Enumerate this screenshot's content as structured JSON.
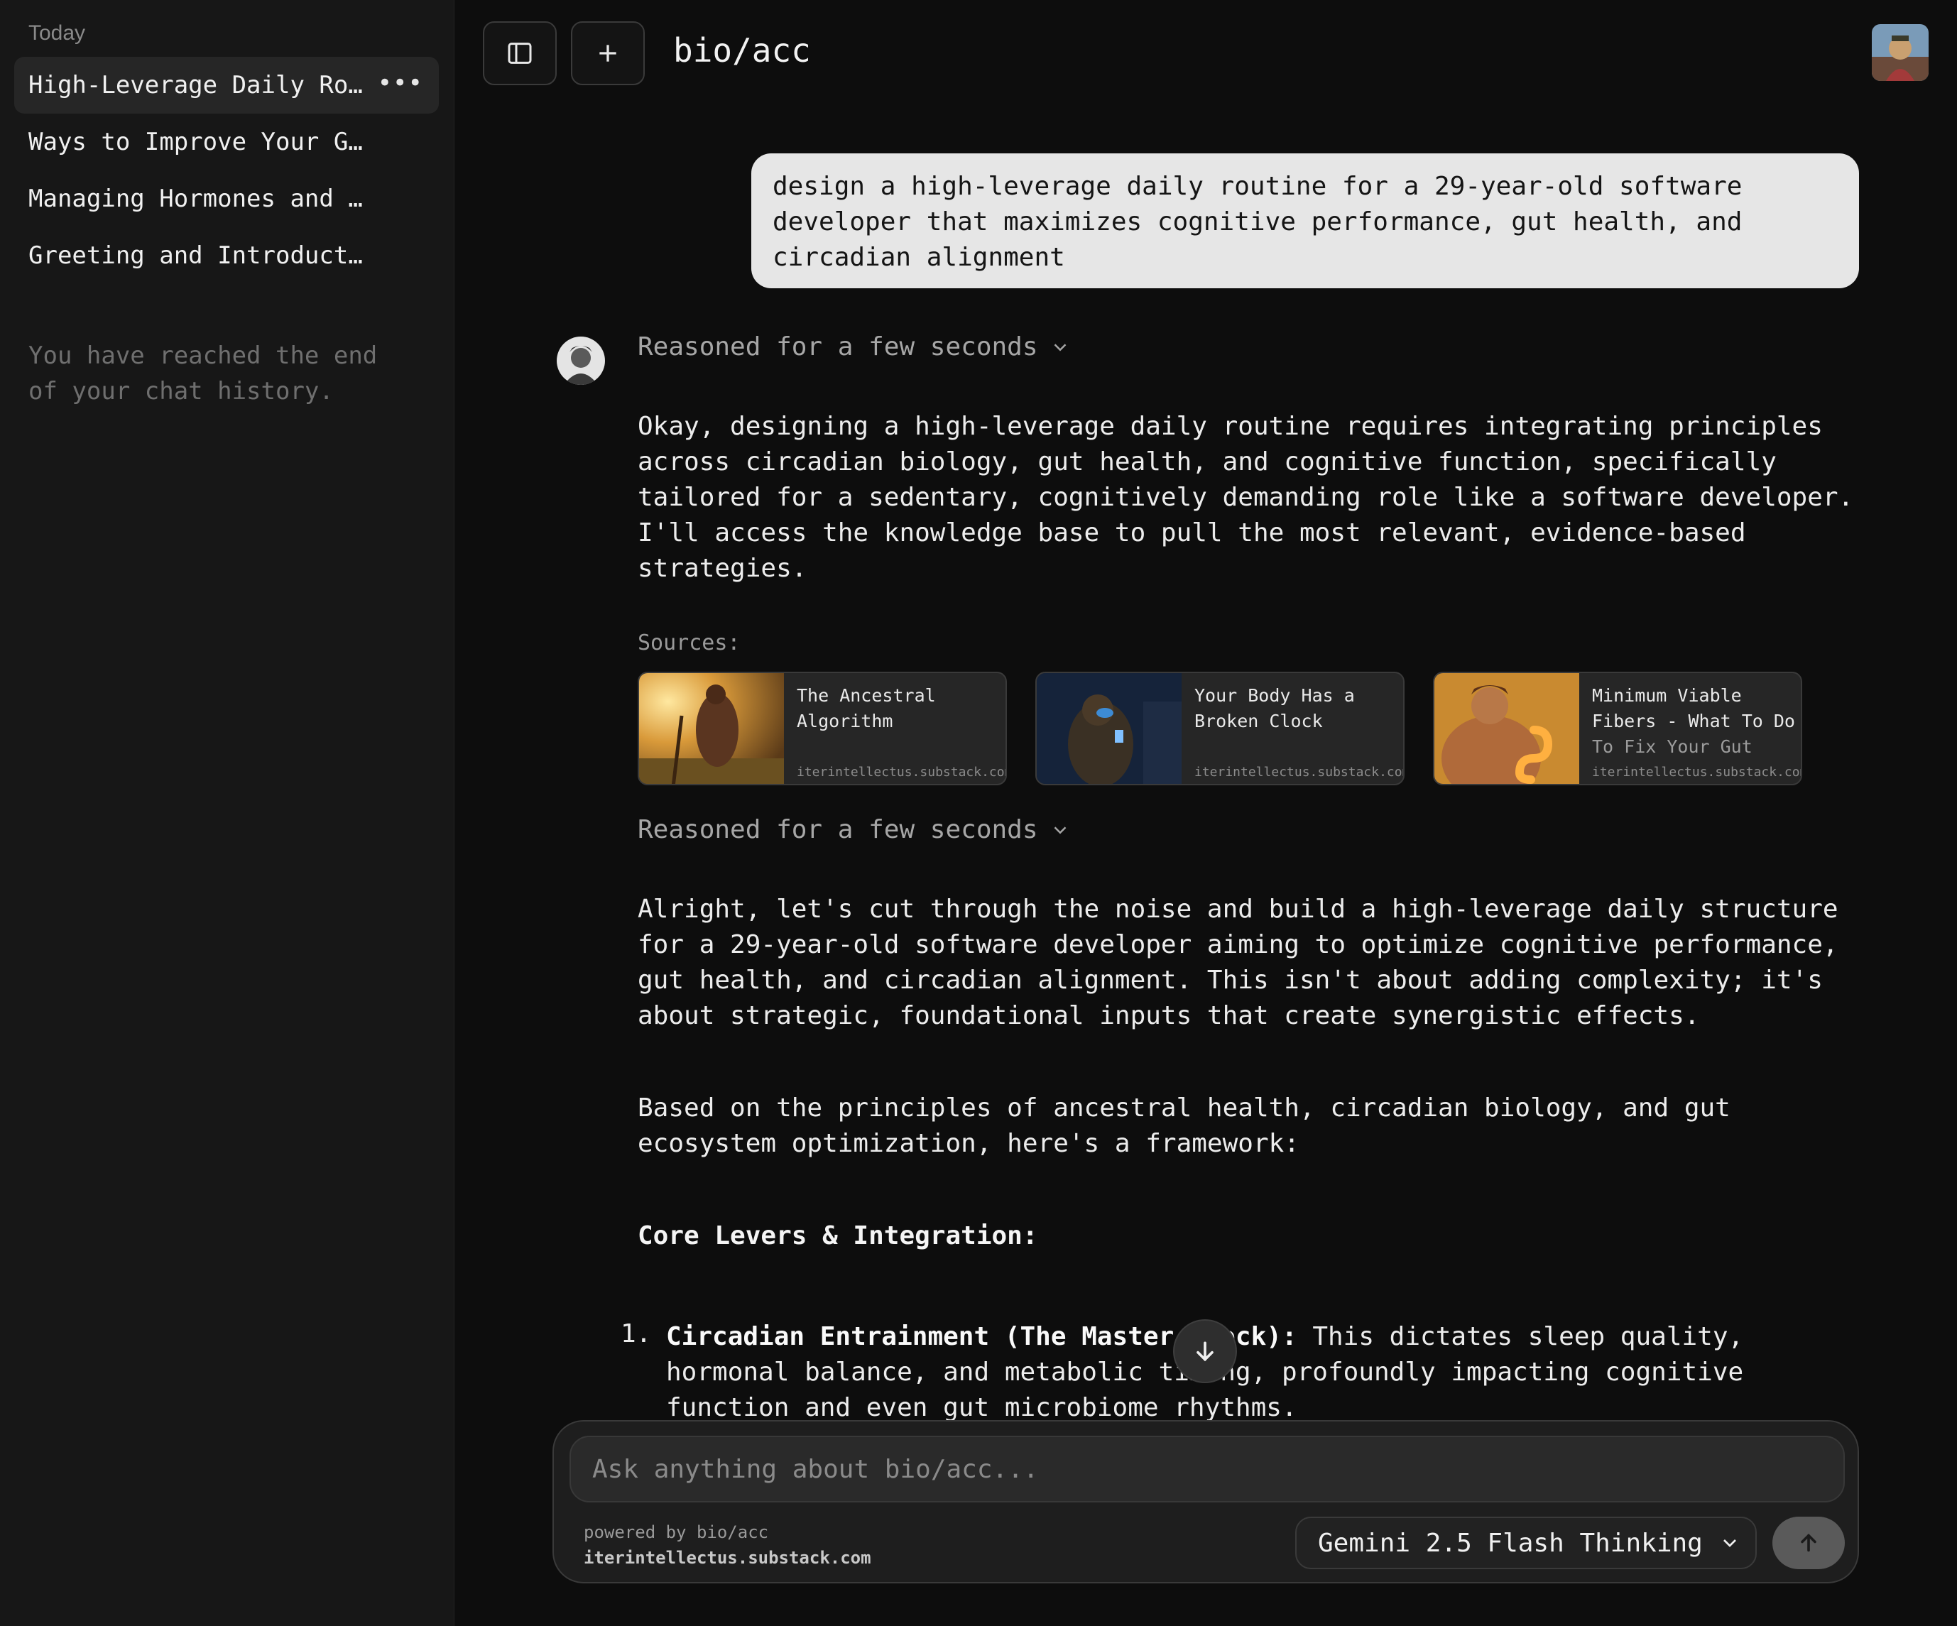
{
  "sidebar": {
    "section_label": "Today",
    "items": [
      {
        "label": "High-Leverage Daily Ro…",
        "active": true
      },
      {
        "label": "Ways to Improve Your G…",
        "active": false
      },
      {
        "label": "Managing Hormones and …",
        "active": false
      },
      {
        "label": "Greeting and Introduct…",
        "active": false
      }
    ],
    "more_icon": "ellipsis-icon",
    "end_text": "You have reached the end of your chat history."
  },
  "header": {
    "title": "bio/acc",
    "toggle_icon": "sidebar-toggle-icon",
    "new_chat_icon": "plus-icon"
  },
  "chat": {
    "user_message": "design a high-leverage daily routine for a 29-year-old software developer that maximizes cognitive performance, gut health, and circadian alignment",
    "reasoning_label_1": "Reasoned for a few seconds",
    "reasoning_label_2": "Reasoned for a few seconds",
    "intro_paragraph": "Okay, designing a high-leverage daily routine requires integrating principles across circadian biology, gut health, and cognitive function, specifically tailored for a sedentary, cognitively demanding role like a software developer. I'll access the knowledge base to pull the most relevant, evidence-based strategies.",
    "sources_label": "Sources:",
    "sources": [
      {
        "title": "The Ancestral Algorithm",
        "title_faded": "",
        "domain": "iterintellectus.substack.com"
      },
      {
        "title": "Your Body Has a Broken Clock",
        "title_faded": "",
        "domain": "iterintellectus.substack.com"
      },
      {
        "title": "Minimum Viable Fibers - What To Do",
        "title_faded": "To Fix Your Gut",
        "domain": "iterintellectus.substack.com"
      }
    ],
    "paragraph_2": "Alright, let's cut through the noise and build a high-leverage daily structure for a 29-year-old software developer aiming to optimize cognitive performance, gut health, and circadian alignment. This isn't about adding complexity; it's about strategic, foundational inputs that create synergistic effects.",
    "paragraph_3": "Based on the principles of ancestral health, circadian biology, and gut ecosystem optimization, here's a framework:",
    "core_heading": "Core Levers & Integration:",
    "list_item_1": {
      "number": "1.",
      "bold": "Circadian Entrainment (The Master Clock):",
      "text": " This dictates sleep quality, hormonal balance, and metabolic timing, profoundly impacting cognitive function and even gut microbiome rhythms."
    }
  },
  "composer": {
    "placeholder": "Ask anything about bio/acc...",
    "powered_by": "powered by bio/acc",
    "powered_domain": "iterintellectus.substack.com",
    "model": "Gemini 2.5 Flash Thinking",
    "send_icon": "arrow-up-icon",
    "scroll_icon": "arrow-down-icon"
  }
}
